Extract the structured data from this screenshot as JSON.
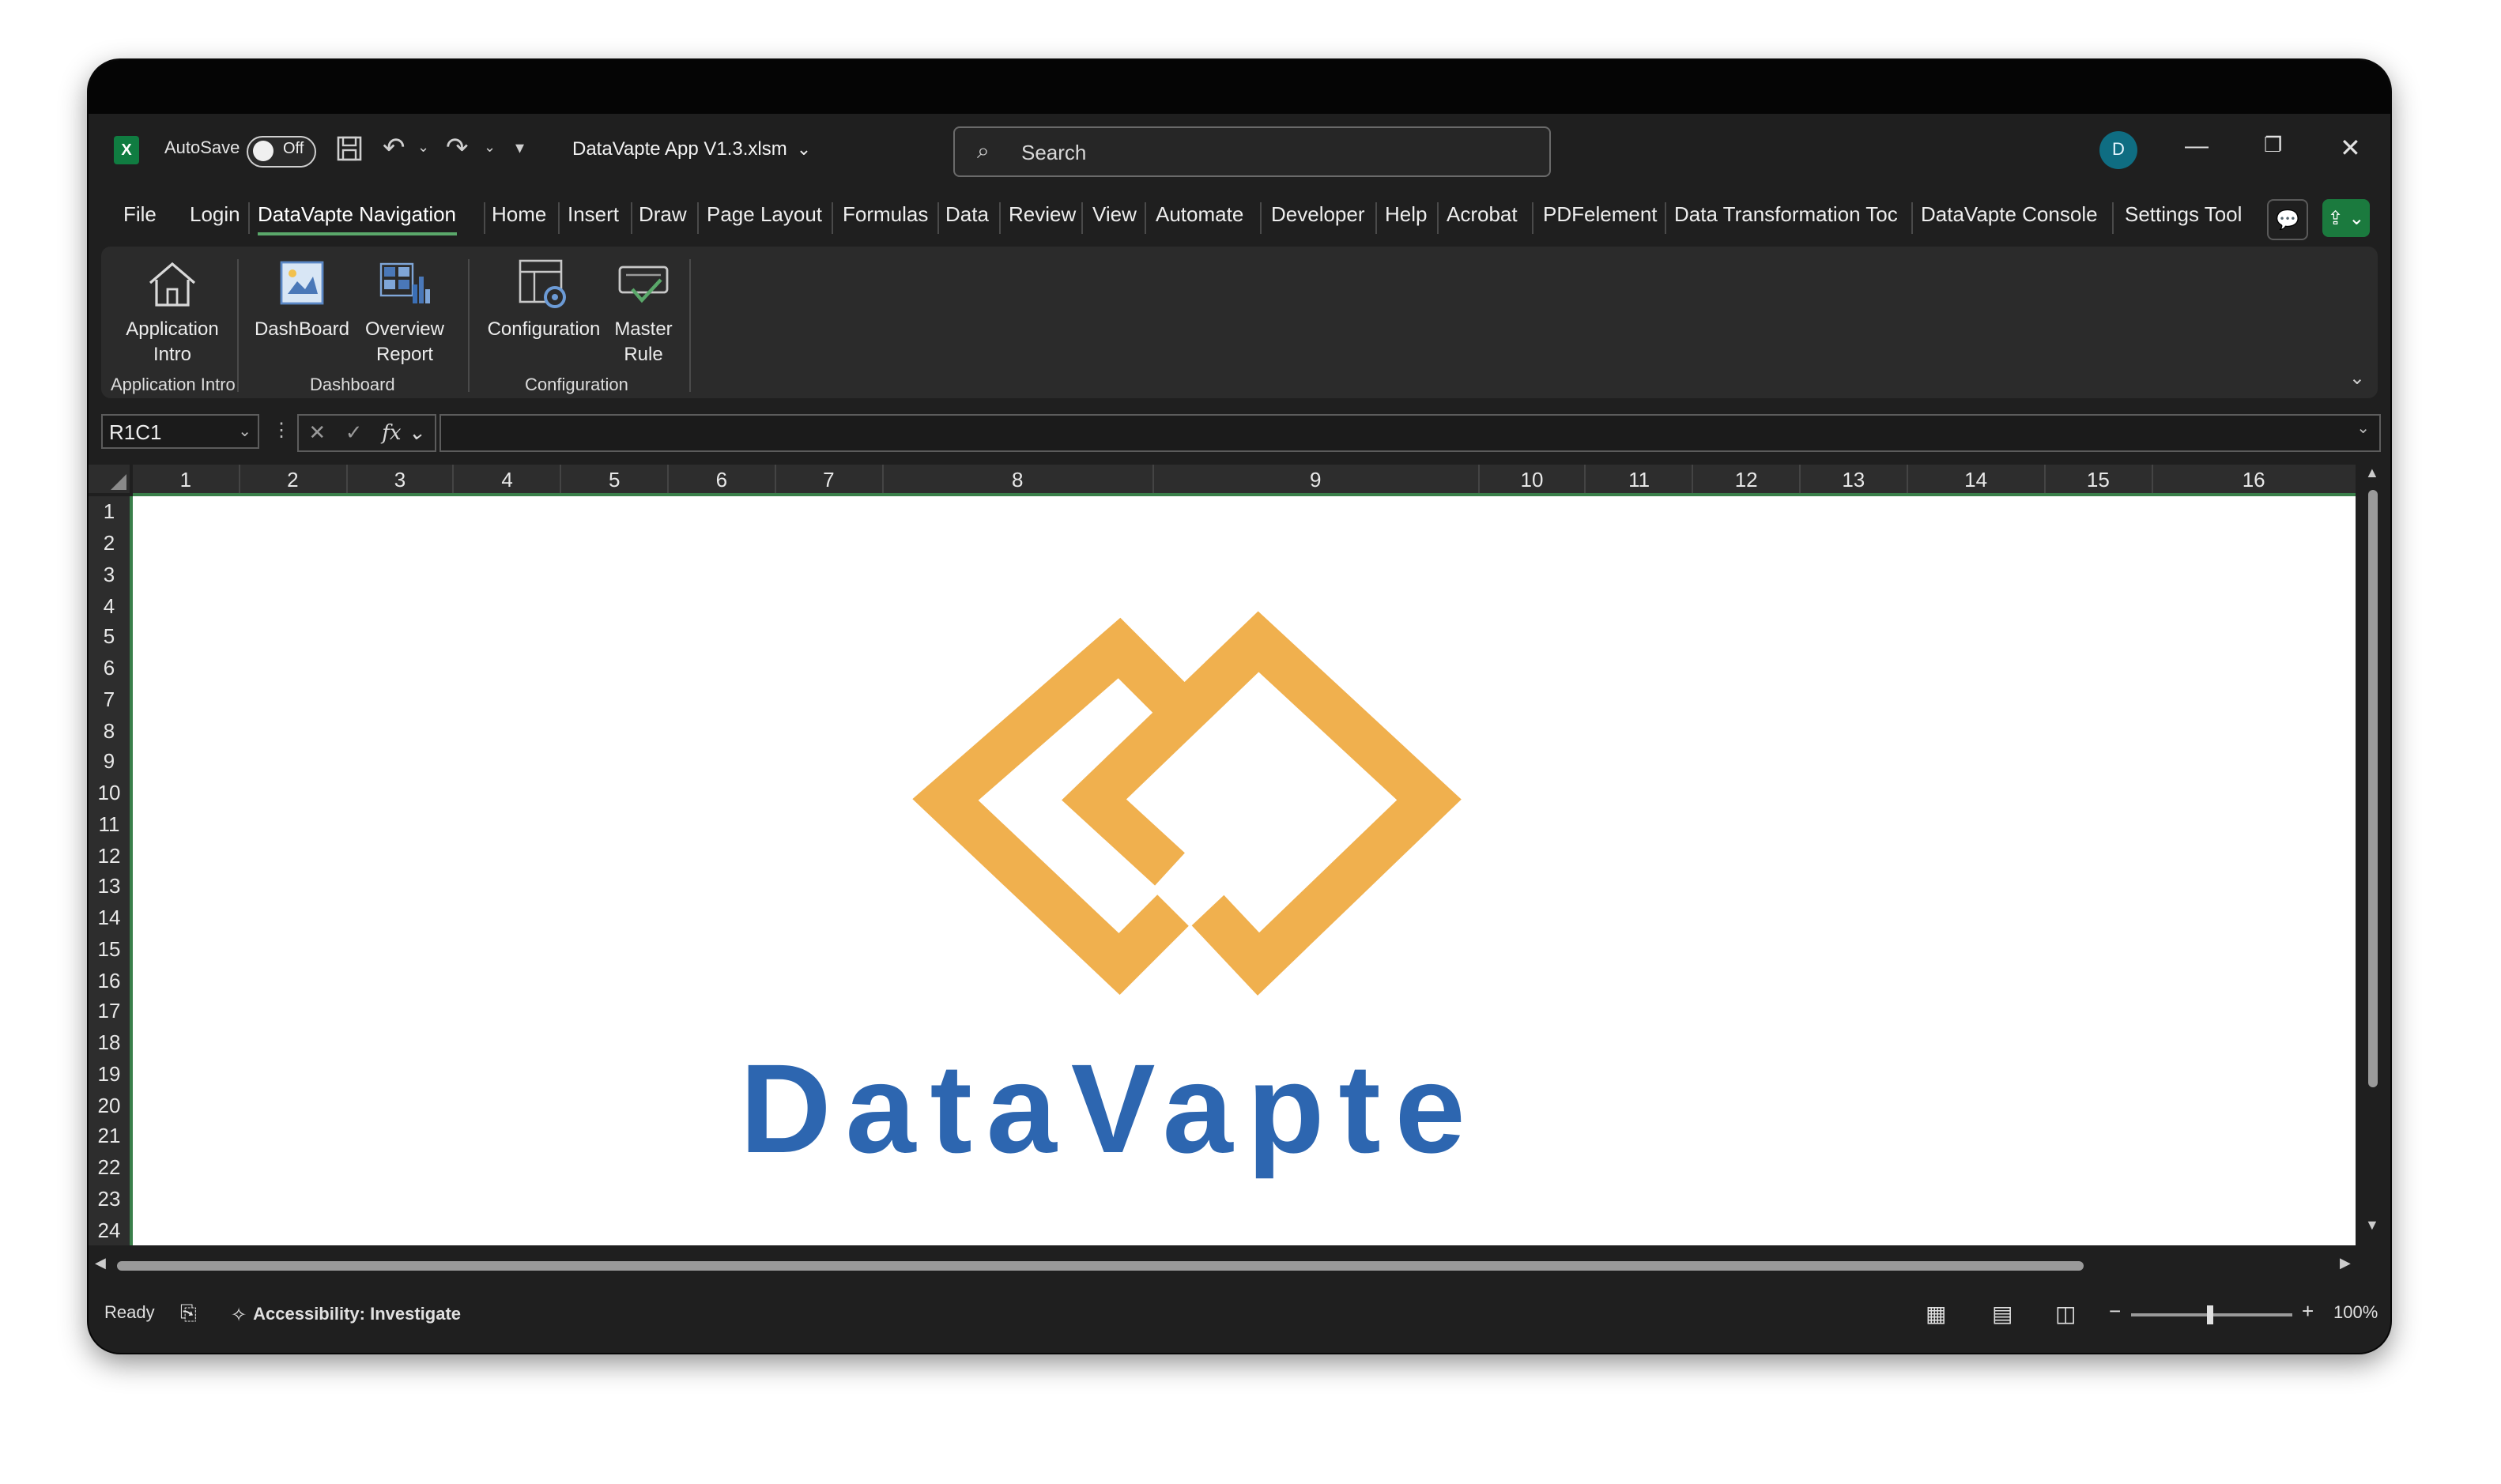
{
  "titlebar": {
    "app_icon": "excel-icon",
    "autosave_label": "AutoSave",
    "autosave_state": "Off",
    "file_name": "DataVapte App V1.3.xlsm",
    "search_placeholder": "Search",
    "avatar_initial": "D"
  },
  "tabs": [
    "File",
    "Login",
    "DataVapte Navigation",
    "Home",
    "Insert",
    "Draw",
    "Page Layout",
    "Formulas",
    "Data",
    "Review",
    "View",
    "Automate",
    "Developer",
    "Help",
    "Acrobat",
    "PDFelement",
    "Data Transformation Toc",
    "DataVapte Console",
    "Settings Tool"
  ],
  "active_tab": "DataVapte Navigation",
  "ribbon": {
    "buttons": {
      "application_intro": "Application\nIntro",
      "dashboard": "DashBoard",
      "overview_report": "Overview\nReport",
      "configuration": "Configuration",
      "master_rule": "Master\nRule"
    },
    "groups": {
      "application_intro": "Application Intro",
      "dashboard": "Dashboard",
      "configuration": "Configuration"
    }
  },
  "formula_bar": {
    "name_box": "R1C1",
    "fx_label": "fx",
    "formula": ""
  },
  "columns": [
    "1",
    "2",
    "3",
    "4",
    "5",
    "6",
    "7",
    "8",
    "9",
    "10",
    "11",
    "12",
    "13",
    "14",
    "15",
    "16"
  ],
  "rows": [
    "1",
    "2",
    "3",
    "4",
    "5",
    "6",
    "7",
    "8",
    "9",
    "10",
    "11",
    "12",
    "13",
    "14",
    "15",
    "16",
    "17",
    "18",
    "19",
    "20",
    "21",
    "22",
    "23",
    "24"
  ],
  "logo": {
    "text": "DataVapte",
    "mark_color": "#f0b04e",
    "text_color": "#2d66b0"
  },
  "status_bar": {
    "ready": "Ready",
    "accessibility": "Accessibility: Investigate",
    "zoom": "100%"
  },
  "colors": {
    "window_bg": "#1f1f1f",
    "ribbon_bg": "#2b2b2b",
    "accent_green": "#5aa86a"
  }
}
